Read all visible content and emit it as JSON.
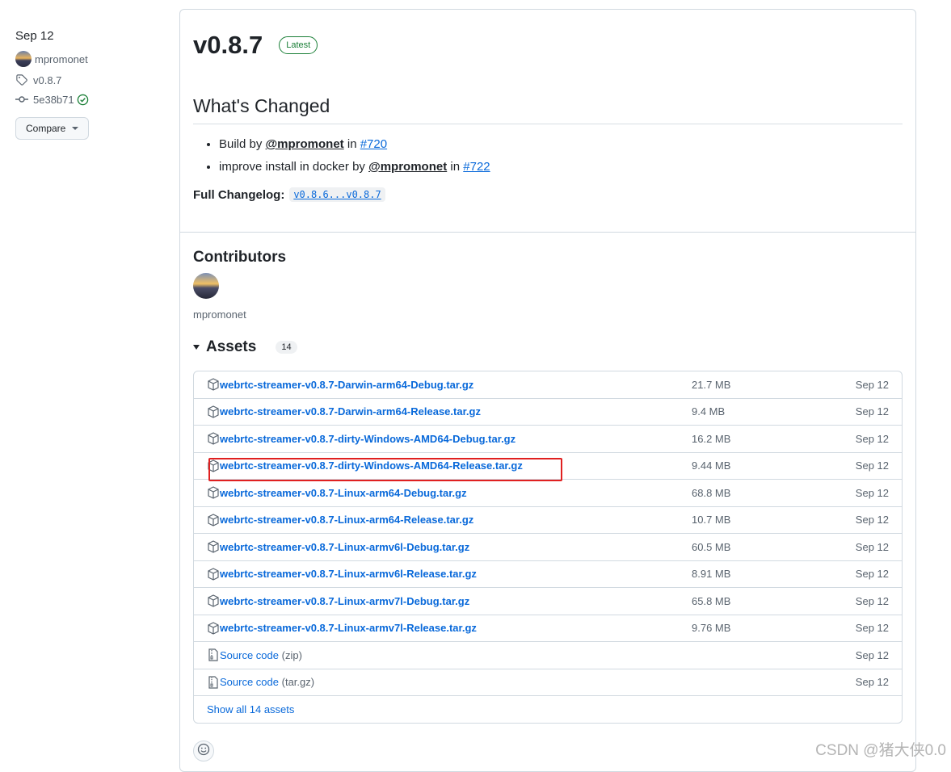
{
  "sidebar": {
    "date": "Sep 12",
    "author": "mpromonet",
    "tag": "v0.8.7",
    "commit": "5e38b71",
    "compare_label": "Compare"
  },
  "release": {
    "title": "v0.8.7",
    "badge": "Latest",
    "changes_heading": "What's Changed",
    "changes": [
      {
        "text": "Build by",
        "mention": "@mpromonet",
        "in": "in",
        "pr": "#720"
      },
      {
        "text": "improve install in docker by",
        "mention": "@mpromonet",
        "in": "in",
        "pr": "#722"
      }
    ],
    "full_changelog_label": "Full Changelog:",
    "full_changelog_link": "v0.8.6...v0.8.7"
  },
  "contributors": {
    "heading": "Contributors",
    "names": [
      "mpromonet"
    ]
  },
  "assets": {
    "heading": "Assets",
    "count": "14",
    "files": [
      {
        "name": "webrtc-streamer-v0.8.7-Darwin-arm64-Debug.tar.gz",
        "size": "21.7 MB",
        "date": "Sep 12"
      },
      {
        "name": "webrtc-streamer-v0.8.7-Darwin-arm64-Release.tar.gz",
        "size": "9.4 MB",
        "date": "Sep 12"
      },
      {
        "name": "webrtc-streamer-v0.8.7-dirty-Windows-AMD64-Debug.tar.gz",
        "size": "16.2 MB",
        "date": "Sep 12"
      },
      {
        "name": "webrtc-streamer-v0.8.7-dirty-Windows-AMD64-Release.tar.gz",
        "size": "9.44 MB",
        "date": "Sep 12"
      },
      {
        "name": "webrtc-streamer-v0.8.7-Linux-arm64-Debug.tar.gz",
        "size": "68.8 MB",
        "date": "Sep 12"
      },
      {
        "name": "webrtc-streamer-v0.8.7-Linux-arm64-Release.tar.gz",
        "size": "10.7 MB",
        "date": "Sep 12"
      },
      {
        "name": "webrtc-streamer-v0.8.7-Linux-armv6l-Debug.tar.gz",
        "size": "60.5 MB",
        "date": "Sep 12"
      },
      {
        "name": "webrtc-streamer-v0.8.7-Linux-armv6l-Release.tar.gz",
        "size": "8.91 MB",
        "date": "Sep 12"
      },
      {
        "name": "webrtc-streamer-v0.8.7-Linux-armv7l-Debug.tar.gz",
        "size": "65.8 MB",
        "date": "Sep 12"
      },
      {
        "name": "webrtc-streamer-v0.8.7-Linux-armv7l-Release.tar.gz",
        "size": "9.76 MB",
        "date": "Sep 12"
      }
    ],
    "source": [
      {
        "name": "Source code",
        "ext": "(zip)",
        "date": "Sep 12"
      },
      {
        "name": "Source code",
        "ext": "(tar.gz)",
        "date": "Sep 12"
      }
    ],
    "show_all": "Show all 14 assets"
  },
  "watermark": "CSDN @猪大侠0.0",
  "colors": {
    "link": "#0969da",
    "latest": "#1a7f37",
    "highlight": "#e02020"
  }
}
